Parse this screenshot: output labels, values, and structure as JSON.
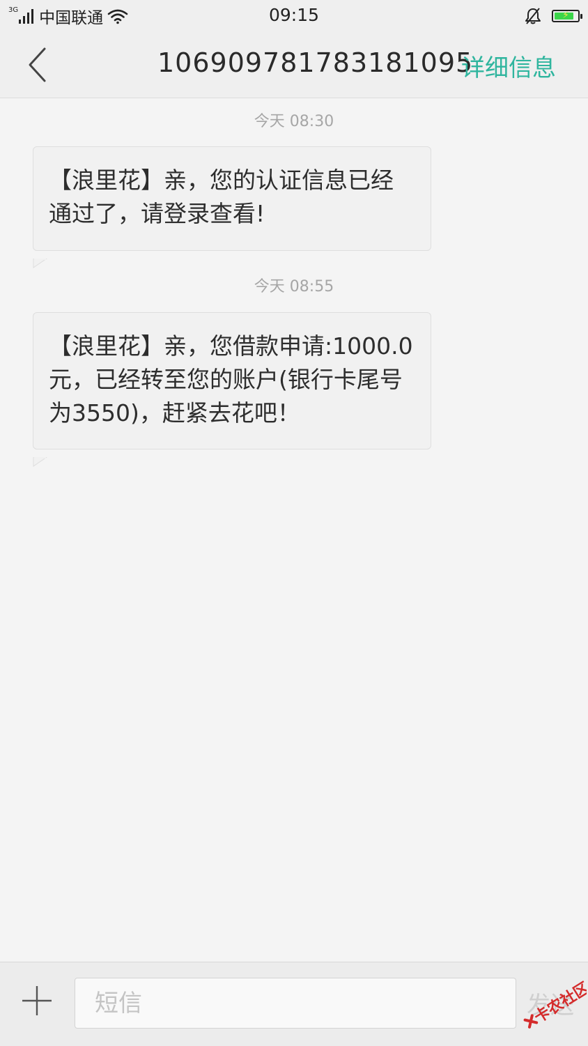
{
  "status_bar": {
    "network": "3G",
    "carrier": "中国联通",
    "time": "09:15",
    "battery_level": 0.85,
    "battery_color": "#3bd54a"
  },
  "header": {
    "title": "1069097817831810​95",
    "detail_link": "详细信息",
    "accent_color": "#2fb59e"
  },
  "messages": [
    {
      "time": "今天  08:30",
      "text": "【浪里花】亲，您的认证信息已经通过了，请登录查看!"
    },
    {
      "time": "今天  08:55",
      "text": "【浪里花】亲，您借款申请:1000.0元，已经转至您的账户(银行卡尾号为3550)，赶紧去花吧！"
    }
  ],
  "composer": {
    "placeholder": "短信",
    "send_label": "发送"
  },
  "watermark": {
    "text": "卡农社区"
  }
}
